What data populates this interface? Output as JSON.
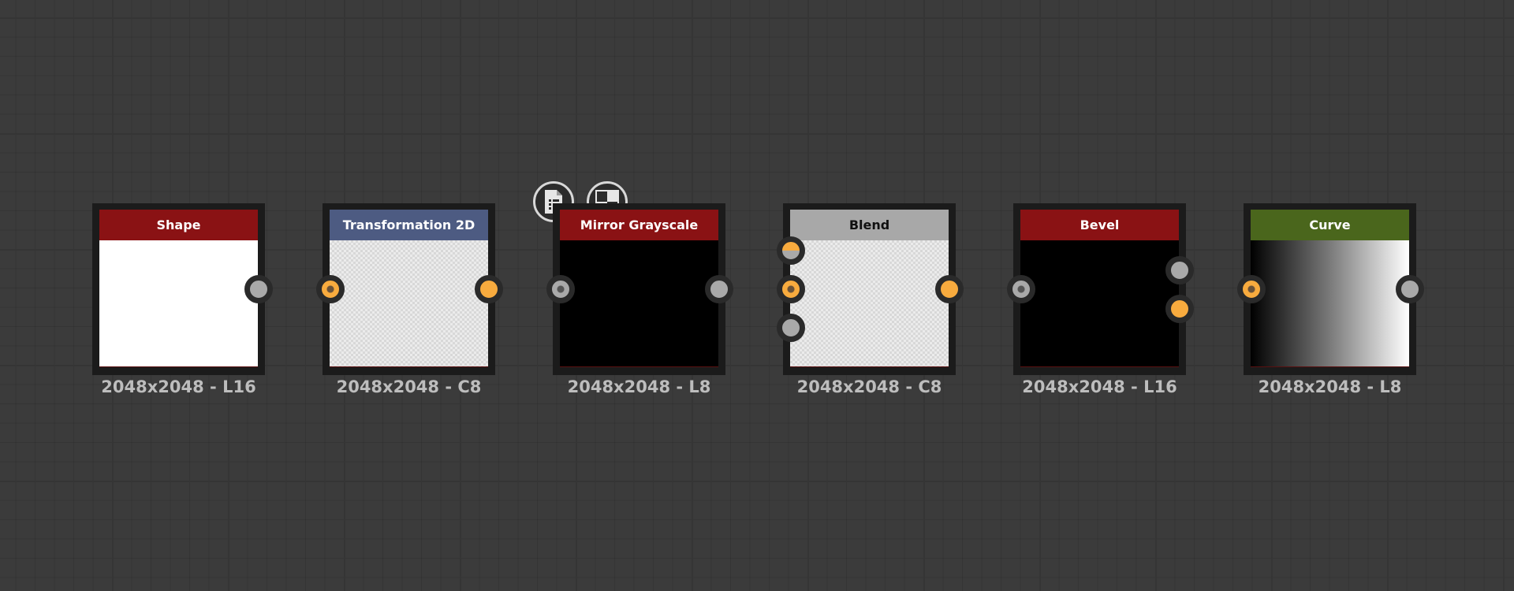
{
  "toolbar": {
    "document_icon": "document-icon",
    "checker_icon": "checkerboard-icon"
  },
  "nodes": [
    {
      "title": "Shape",
      "header_color": "#8a1214",
      "header_text_color": "#ffffff",
      "preview": "white",
      "label": "2048x2048 - L16"
    },
    {
      "title": "Transformation 2D",
      "header_color": "#4d5b82",
      "header_text_color": "#ffffff",
      "preview": "checker",
      "label": "2048x2048 - C8"
    },
    {
      "title": "Mirror Grayscale",
      "header_color": "#8a1214",
      "header_text_color": "#ffffff",
      "preview": "black",
      "label": "2048x2048 - L8"
    },
    {
      "title": "Blend",
      "header_color": "#a8a8a8",
      "header_text_color": "#111111",
      "preview": "checker",
      "label": "2048x2048 - C8"
    },
    {
      "title": "Bevel",
      "header_color": "#8a1214",
      "header_text_color": "#ffffff",
      "preview": "black",
      "label": "2048x2048 - L16"
    },
    {
      "title": "Curve",
      "header_color": "#4a661c",
      "header_text_color": "#ffffff",
      "preview": "gradient",
      "label": "2048x2048 - L8"
    }
  ],
  "colors": {
    "canvas_bg": "#3b3b3b",
    "node_frame": "#1b1b1b",
    "port_gray": "#a9a9a9",
    "port_orange": "#f8ab3e",
    "label_text": "#bdbdbd"
  }
}
